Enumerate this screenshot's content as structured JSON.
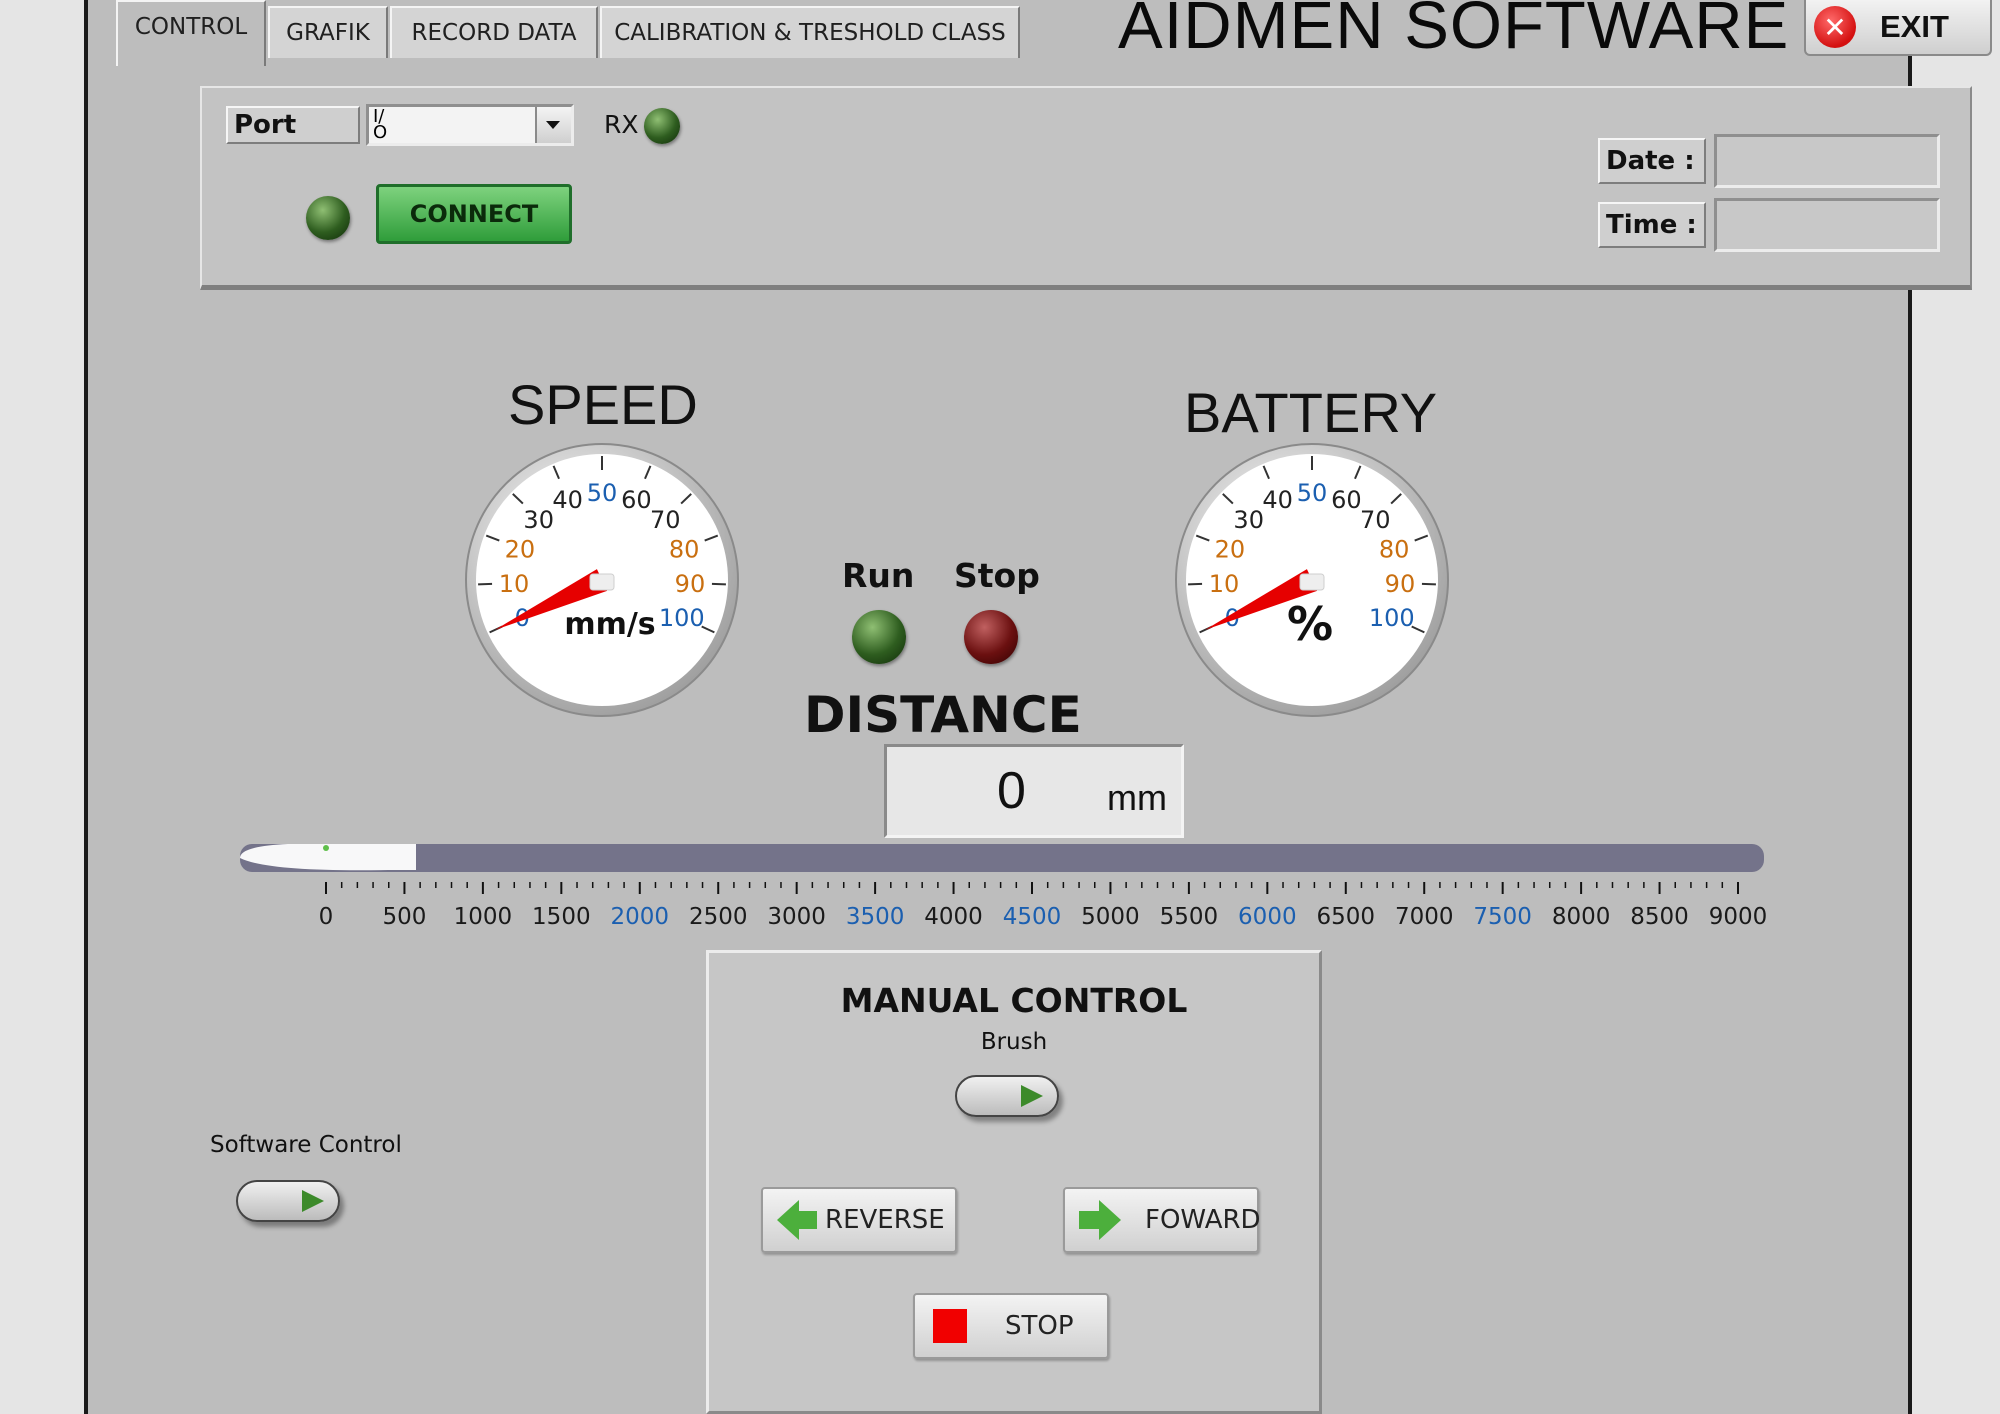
{
  "tabs": [
    {
      "label": "CONTROL",
      "active": true
    },
    {
      "label": "GRAFIK",
      "active": false
    },
    {
      "label": "RECORD DATA",
      "active": false
    },
    {
      "label": "CALIBRATION & TRESHOLD CLASS",
      "active": false
    }
  ],
  "app_title": "AIDMEN SOFTWARE",
  "exit": {
    "label": "EXIT",
    "icon": "close-icon"
  },
  "connection": {
    "port_label": "Port",
    "port_value": "",
    "rx_label": "RX",
    "connect_label": "CONNECT",
    "date_label": "Date :",
    "date_value": "",
    "time_label": "Time :",
    "time_value": ""
  },
  "speed_gauge": {
    "title": "SPEED",
    "unit": "mm/s",
    "ticks": [
      "0",
      "10",
      "20",
      "30",
      "40",
      "50",
      "60",
      "70",
      "80",
      "90",
      "100"
    ],
    "value": 0
  },
  "battery_gauge": {
    "title": "BATTERY",
    "unit": "%",
    "ticks": [
      "0",
      "10",
      "20",
      "30",
      "40",
      "50",
      "60",
      "70",
      "80",
      "90",
      "100"
    ],
    "value": 0
  },
  "status": {
    "run_label": "Run",
    "stop_label": "Stop"
  },
  "distance": {
    "title": "DISTANCE",
    "value": "0",
    "unit": "mm"
  },
  "distance_slider": {
    "ticks": [
      "0",
      "500",
      "1000",
      "1500",
      "2000",
      "2500",
      "3000",
      "3500",
      "4000",
      "4500",
      "5000",
      "5500",
      "6000",
      "6500",
      "7000",
      "7500",
      "8000",
      "8500",
      "9000"
    ],
    "min": 0,
    "max": 9000,
    "value": 0
  },
  "manual_control": {
    "title": "MANUAL CONTROL",
    "brush_label": "Brush",
    "reverse_label": "REVERSE",
    "forward_label": "FOWARD",
    "stop_label": "STOP"
  },
  "software_control": {
    "label": "Software Control"
  },
  "colors": {
    "tick_blue": "#1b5fb0",
    "tick_orange": "#c96f10",
    "needle": "#e60000",
    "led_green": "#2e5d1f",
    "led_red": "#6b1010"
  }
}
